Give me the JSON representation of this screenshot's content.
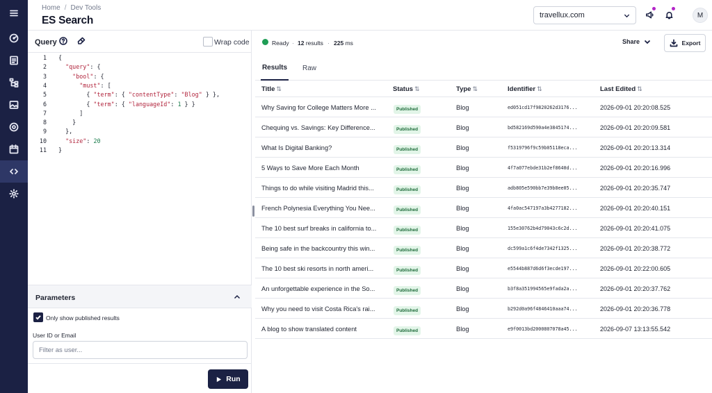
{
  "rail": {
    "icons": [
      "menu-icon",
      "dashboard-icon",
      "content-icon",
      "schema-icon",
      "media-icon",
      "target-icon",
      "calendar-icon",
      "dev-tools-icon",
      "settings-icon"
    ]
  },
  "header": {
    "breadcrumb": [
      "Home",
      "Dev Tools"
    ],
    "title": "ES Search",
    "site": "travellux.com"
  },
  "avatar_initial": "M",
  "query": {
    "label": "Query",
    "wrap_label": "Wrap code",
    "wrap_checked": false,
    "lines": [
      "{",
      "  \"query\": {",
      "    \"bool\": {",
      "      \"must\": [",
      "        { \"term\": { \"contentType\": \"Blog\" } },",
      "        { \"term\": { \"languageId\": 1 } }",
      "      ]",
      "    }",
      "  },",
      "  \"size\": 20",
      "}"
    ]
  },
  "parameters": {
    "title": "Parameters",
    "published_label": "Only show published results",
    "published_checked": true,
    "user_label": "User ID or Email",
    "user_placeholder": "Filter as user...",
    "run_label": "Run"
  },
  "status": {
    "state": "Ready",
    "results_count": "12",
    "results_word": "results",
    "time_value": "225",
    "time_unit": "ms"
  },
  "actions": {
    "share": "Share",
    "export": "Export"
  },
  "tabs": [
    "Results",
    "Raw"
  ],
  "columns": [
    "Title",
    "Status",
    "Type",
    "Identifier",
    "Last Edited"
  ],
  "rows": [
    {
      "title": "Why Saving for College Matters More ...",
      "status": "Published",
      "type": "Blog",
      "id": "ed051cd17f9820262d3176...",
      "edited": "2026-09-01 20:20:08.525"
    },
    {
      "title": "Chequing vs. Savings: Key Difference...",
      "status": "Published",
      "type": "Blog",
      "id": "bd582169d590a4e3845174...",
      "edited": "2026-09-01 20:20:09.581"
    },
    {
      "title": "What Is Digital Banking?",
      "status": "Published",
      "type": "Blog",
      "id": "f5319796f9c59b05118eca...",
      "edited": "2026-09-01 20:20:13.314"
    },
    {
      "title": "5 Ways to Save More Each Month",
      "status": "Published",
      "type": "Blog",
      "id": "4f7a077ebde31b2ef8640d...",
      "edited": "2026-09-01 20:20:16.996"
    },
    {
      "title": "Things to do while visiting Madrid this...",
      "status": "Published",
      "type": "Blog",
      "id": "adb805e590bb7e39b8ee05...",
      "edited": "2026-09-01 20:20:35.747"
    },
    {
      "title": "French Polynesia Everything You Nee...",
      "status": "Published",
      "type": "Blog",
      "id": "4fa0ac547197a3b4277182...",
      "edited": "2026-09-01 20:20:40.151"
    },
    {
      "title": "The 10 best surf breaks in california to...",
      "status": "Published",
      "type": "Blog",
      "id": "155e30762b4d79043c6c2d...",
      "edited": "2026-09-01 20:20:41.075"
    },
    {
      "title": "Being safe in the backcountry this win...",
      "status": "Published",
      "type": "Blog",
      "id": "dc599a1c6f4de7342f1325...",
      "edited": "2026-09-01 20:20:38.772"
    },
    {
      "title": "The 10 best ski resorts in north ameri...",
      "status": "Published",
      "type": "Blog",
      "id": "e5544b887d6d6f3ecde197...",
      "edited": "2026-09-01 20:22:00.605"
    },
    {
      "title": "An unforgettable experience in the So...",
      "status": "Published",
      "type": "Blog",
      "id": "b3f8a351994565e9fada2a...",
      "edited": "2026-09-01 20:20:37.762"
    },
    {
      "title": "Why you need to visit Costa Rica's rai...",
      "status": "Published",
      "type": "Blog",
      "id": "b292d0a96f4846410aaa74...",
      "edited": "2026-09-01 20:20:36.778"
    },
    {
      "title": "A blog to show translated content",
      "status": "Published",
      "type": "Blog",
      "id": "e9f0013bd2000807078a45...",
      "edited": "2026-09-07 13:13:55.542"
    }
  ],
  "colors": {
    "rail": "#1b2144",
    "rail_active": "#2e3766",
    "accent": "#1b2144",
    "ready": "#1f9d55",
    "notify_dot": "#b325c8",
    "badge_text": "#1e6b3a",
    "badge_bg": "#e2f5e8"
  }
}
